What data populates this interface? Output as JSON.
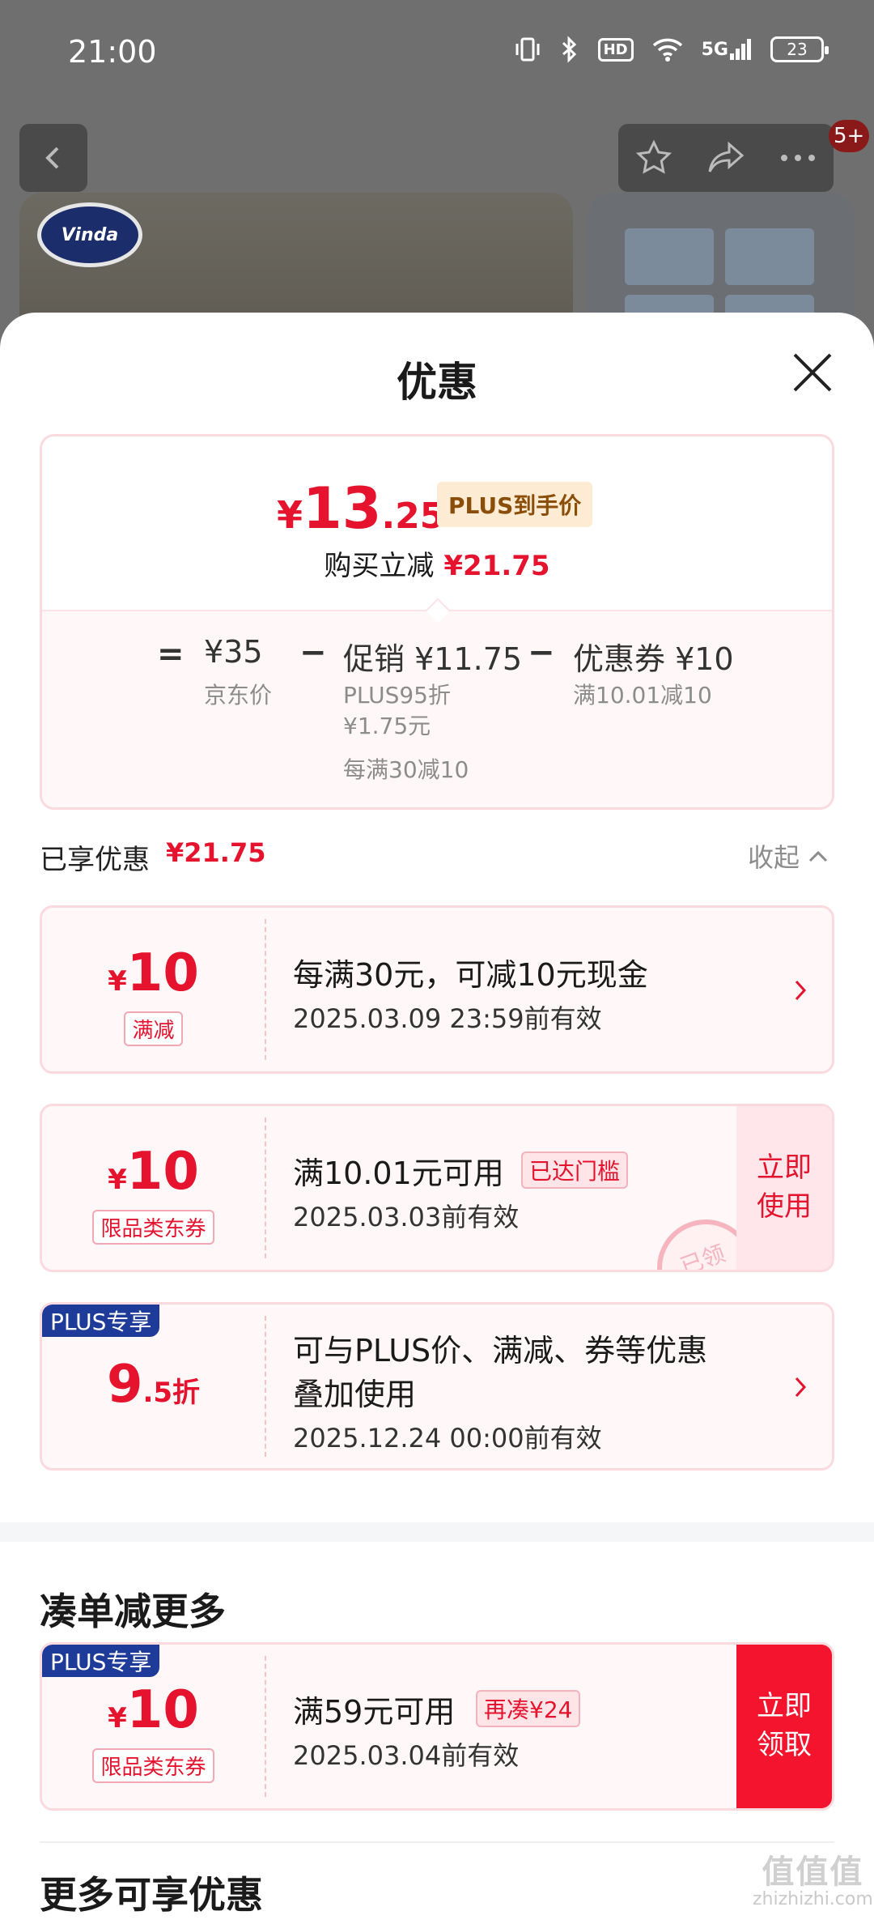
{
  "status_bar": {
    "time": "21:00",
    "network": "5G",
    "hd": "HD",
    "battery": "23"
  },
  "background": {
    "brand_logo": "Vinda",
    "badge_count": "5+"
  },
  "sheet": {
    "title": "优惠"
  },
  "summary": {
    "currency": "¥",
    "final_price_int": "13",
    "final_price_dec": ".25",
    "plus_tag": "PLUS到手价",
    "instant_label": "购买立减",
    "instant_amount": "¥21.75",
    "eq": "=",
    "minus": "−",
    "jd_price": "¥35",
    "jd_price_label": "京东价",
    "promo_title": "促销 ¥11.75",
    "promo_line1": "PLUS95折",
    "promo_line2": "¥1.75元",
    "promo_line3": "每满30减10",
    "coupon_title": "优惠券 ¥10",
    "coupon_line1": "满10.01减10"
  },
  "enjoyed": {
    "label": "已享优惠",
    "amount": "¥21.75",
    "collapse": "收起"
  },
  "coupons": [
    {
      "yen": "¥",
      "value": "10",
      "tag": "满减",
      "desc": "每满30元，可减10元现金",
      "date": "2025.03.09 23:59前有效"
    },
    {
      "yen": "¥",
      "value": "10",
      "tag": "限品类东券",
      "desc": "满10.01元可用",
      "reach": "已达门槛",
      "date": "2025.03.03前有效",
      "button": "立即\n使用",
      "stamp": "已领"
    },
    {
      "plus": "PLUS专享",
      "value_int": "9",
      "value_dec": ".5折",
      "desc1": "可与PLUS价、满减、券等优惠",
      "desc2": "叠加使用",
      "date": "2025.12.24 00:00前有效"
    }
  ],
  "more_section": {
    "title": "凑单减更多",
    "coupon": {
      "plus": "PLUS专享",
      "yen": "¥",
      "value": "10",
      "tag": "限品类东券",
      "desc": "满59元可用",
      "reach": "再凑¥24",
      "date": "2025.03.04前有效",
      "button": "立即\n领取"
    }
  },
  "more_discounts": {
    "title": "更多可享优惠"
  },
  "watermark": {
    "big": "值值值",
    "small": "zhizhizhi.com"
  },
  "colors": {
    "accent": "#e5132d",
    "plus_blue": "#1f3b9a",
    "card_bg": "#fff7f8",
    "border": "#fbdadf"
  }
}
